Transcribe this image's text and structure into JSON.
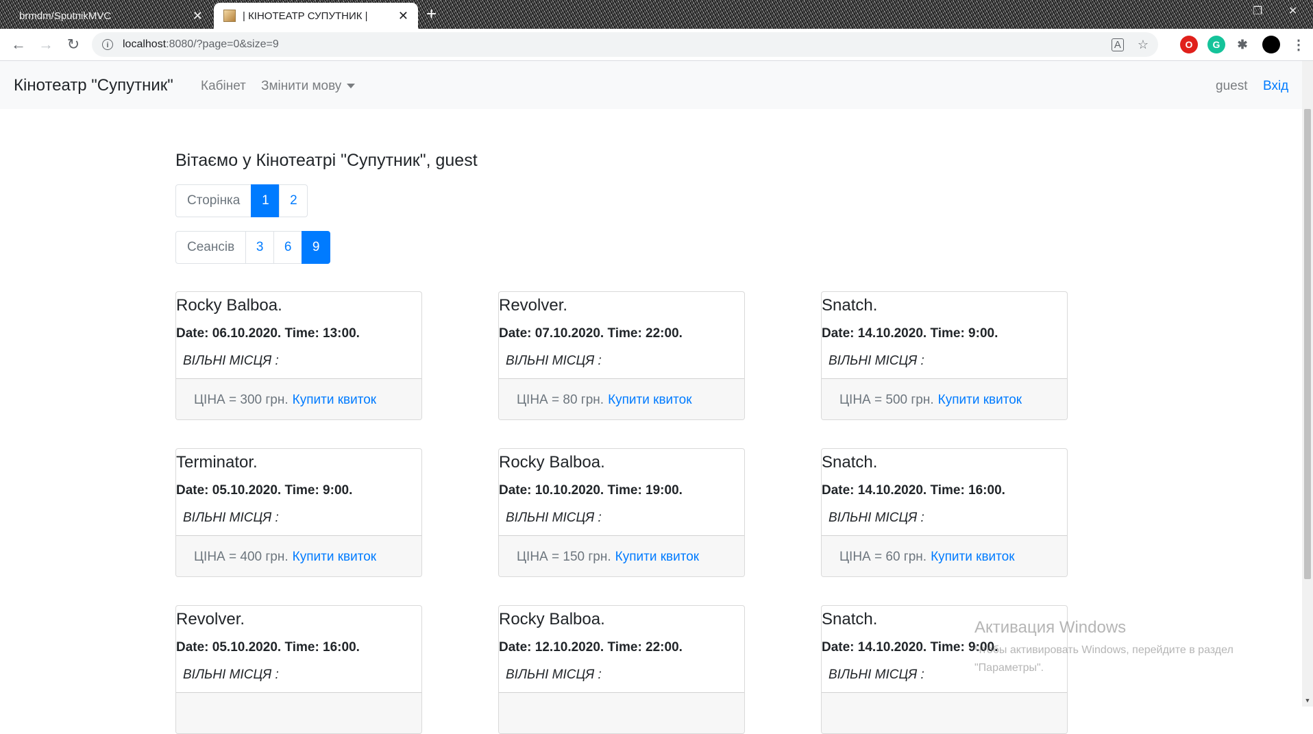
{
  "browser": {
    "tabs": [
      {
        "title": "brmdm/SputnikMVC",
        "active": false
      },
      {
        "title": "| КІНОТЕАТР СУПУТНИК |",
        "active": true
      }
    ],
    "new_tab": "+",
    "close": "✕",
    "url_host": "localhost",
    "url_rest": ":8080/?page=0&size=9",
    "info_icon": "i"
  },
  "navbar": {
    "brand": "Кінотеатр \"Супутник\"",
    "links": [
      "Кабінет",
      "Змінити мову"
    ],
    "user": "guest",
    "login": "Вхід"
  },
  "main": {
    "welcome": "Вітаємо у Кінотеатрі \"Супутник\", guest",
    "page_pager": {
      "label": "Сторінка",
      "items": [
        "1",
        "2"
      ],
      "active": "1"
    },
    "size_pager": {
      "label": "Сеансів",
      "items": [
        "3",
        "6",
        "9"
      ],
      "active": "9"
    },
    "seats_label": "ВІЛЬНІ МІСЦЯ :",
    "buy_label": "Купити квиток",
    "sessions": [
      {
        "title": "Rocky Balboa.",
        "datetime": "Date: 06.10.2020. Time: 13:00.",
        "price": "ЦІНА = 300 грн."
      },
      {
        "title": "Revolver.",
        "datetime": "Date: 07.10.2020. Time: 22:00.",
        "price": "ЦІНА = 80 грн."
      },
      {
        "title": "Snatch.",
        "datetime": "Date: 14.10.2020. Time: 9:00.",
        "price": "ЦІНА = 500 грн."
      },
      {
        "title": "Terminator.",
        "datetime": "Date: 05.10.2020. Time: 9:00.",
        "price": "ЦІНА = 400 грн."
      },
      {
        "title": "Rocky Balboa.",
        "datetime": "Date: 10.10.2020. Time: 19:00.",
        "price": "ЦІНА = 150 грн."
      },
      {
        "title": "Snatch.",
        "datetime": "Date: 14.10.2020. Time: 16:00.",
        "price": "ЦІНА = 60 грн."
      },
      {
        "title": "Revolver.",
        "datetime": "Date: 05.10.2020. Time: 16:00.",
        "price": ""
      },
      {
        "title": "Rocky Balboa.",
        "datetime": "Date: 12.10.2020. Time: 22:00.",
        "price": ""
      },
      {
        "title": "Snatch.",
        "datetime": "Date: 14.10.2020. Time: 9:00.",
        "price": ""
      }
    ]
  },
  "watermark": {
    "title": "Активация Windows",
    "text": "Чтобы активировать Windows, перейдите в раздел \"Параметры\"."
  },
  "colors": {
    "primary": "#007bff",
    "navbar_bg": "#f8f9fa"
  }
}
